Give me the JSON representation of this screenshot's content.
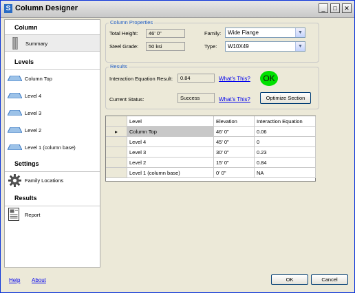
{
  "window": {
    "title": "Column Designer",
    "app_icon": "S",
    "controls": {
      "minimize": "_",
      "maximize": "□",
      "close": "✕"
    }
  },
  "sidebar": {
    "sections": [
      {
        "label": "Column",
        "items": [
          {
            "label": "Summary",
            "icon": "column-icon",
            "selected": true
          }
        ]
      },
      {
        "label": "Levels",
        "items": [
          {
            "label": "Column Top",
            "icon": "level-icon"
          },
          {
            "label": "Level 4",
            "icon": "level-icon"
          },
          {
            "label": "Level 3",
            "icon": "level-icon"
          },
          {
            "label": "Level 2",
            "icon": "level-icon"
          },
          {
            "label": "Level 1 (column base)",
            "icon": "level-icon"
          }
        ]
      },
      {
        "label": "Settings",
        "items": [
          {
            "label": "Family Locations",
            "icon": "gear-icon"
          }
        ]
      },
      {
        "label": "Results",
        "items": [
          {
            "label": "Report",
            "icon": "report-icon"
          }
        ]
      }
    ]
  },
  "properties": {
    "group_label": "Column Properties",
    "total_height_label": "Total Height:",
    "total_height": "46' 0\"",
    "steel_grade_label": "Steel Grade:",
    "steel_grade": "50 ksi",
    "family_label": "Family:",
    "family": "Wide Flange",
    "type_label": "Type:",
    "type": "W10X49"
  },
  "results": {
    "group_label": "Results",
    "ier_label": "Interaction Equation Result:",
    "ier_value": "0.84",
    "whats_this": "What's This?",
    "status_label": "Current Status:",
    "status_value": "Success",
    "ok_badge": "OK",
    "ok_color": "#00e000",
    "optimize_button": "Optimize Section"
  },
  "table": {
    "headers": [
      "Level",
      "Elevation",
      "Interaction Equation"
    ],
    "current_row_marker": "▸",
    "rows": [
      {
        "level": "Column Top",
        "elevation": "46' 0\"",
        "ie": "0.06",
        "selected": true
      },
      {
        "level": "Level 4",
        "elevation": "45' 0\"",
        "ie": "0"
      },
      {
        "level": "Level 3",
        "elevation": "30' 0\"",
        "ie": "0.23"
      },
      {
        "level": "Level 2",
        "elevation": "15' 0\"",
        "ie": "0.84"
      },
      {
        "level": "Level 1 (column base)",
        "elevation": "0' 0\"",
        "ie": "NA"
      }
    ]
  },
  "footer": {
    "help": "Help",
    "about": "About",
    "ok_button": "OK",
    "cancel_button": "Cancel"
  }
}
